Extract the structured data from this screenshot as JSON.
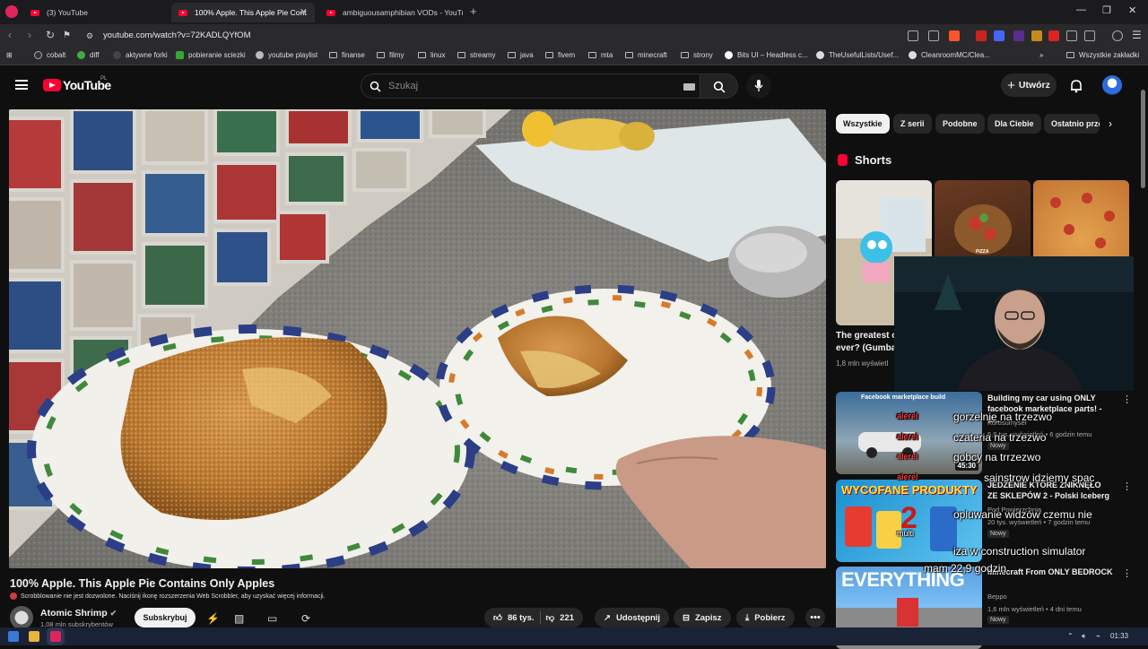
{
  "browser": {
    "tabs": [
      {
        "label": "(3) YouTube",
        "active": false
      },
      {
        "label": "100% Apple. This Apple Pie Cont",
        "active": true
      },
      {
        "label": "ambiguousamphibian VODs - YouTu",
        "active": false
      }
    ],
    "new_tab": "+",
    "window_controls": {
      "minimize": "—",
      "restore": "❐",
      "close": "✕"
    },
    "url": "youtube.com/watch?v=72KADLQYfOM",
    "bookmarks": [
      "cobalt",
      "diff",
      "aktywne forki",
      "pobieranie sciezki",
      "youtube playlist",
      "finanse",
      "filmy",
      "linux",
      "streamy",
      "java",
      "fivem",
      "mta",
      "minecraft",
      "strony",
      "Bits UI – Headless c...",
      "TheUsefulLists/Usef...",
      "CleanroomMC/Clea..."
    ],
    "bookmarks_overflow": "»",
    "other_bookmarks": "Wszystkie zakładki"
  },
  "youtube": {
    "logo_text": "YouTube",
    "country_code": "PL",
    "search_placeholder": "Szukaj",
    "create_label": "Utwórz"
  },
  "video": {
    "title": "100% Apple. This Apple Pie Contains Only Apples",
    "scrobbler_notice": "Scrobblowanie nie jest dozwolone. Naciśnij ikonę rozszerzenia Web Scrobbler, aby uzyskać więcej informacji.",
    "channel": "Atomic Shrimp",
    "subscribers": "1,08 mln subskrybentów",
    "subscribe_label": "Subskrybuj",
    "likes": "86 tys.",
    "dislikes": "221",
    "share_label": "Udostępnij",
    "save_label": "Zapisz",
    "download_label": "Pobierz",
    "more_label": "•••"
  },
  "sidebar": {
    "chips": [
      "Wszystkie",
      "Z serii",
      "Podobne",
      "Dla Ciebie",
      "Ostatnio przesłane"
    ],
    "shorts_heading": "Shorts",
    "shorts": [
      {
        "title": "The greatest c ever? (Gumba",
        "views": "1,8 mln wyświetl"
      },
      {
        "title": "",
        "views": ""
      },
      {
        "title": "",
        "views": ""
      }
    ],
    "shorts_tags": {
      "short_2_label": "PIZZA"
    },
    "recommendations": [
      {
        "title": "Building my car using ONLY facebook marketplace parts! - E...",
        "channel": "Korosumyser",
        "meta": "5,8 tys. wyświetleń • 6 godzin temu",
        "badge": "Nowy",
        "duration": "45:30",
        "thumb_text": "Facebook marketplace build"
      },
      {
        "title": "JEDZENIE KTÓRE ZNIKNĘŁO ZE SKLEPÓW 2 - Polski Iceberg",
        "channel": "Pod Powierzchnią",
        "meta": "20 tys. wyświetleń • 7 godzin temu",
        "badge": "Nowy",
        "duration": "",
        "thumb_text": "WYCOFANE PRODUKTY"
      },
      {
        "title": "Minecraft From ONLY BEDROCK",
        "channel": "Beppo",
        "meta": "1,6 mln wyświetleń • 4 dni temu",
        "badge": "Nowy",
        "duration": "",
        "thumb_text": "EVERYTHING"
      }
    ]
  },
  "chat_overlay": [
    "gorzelnie na trzezwo",
    "alerel",
    "czateria na trzezwo",
    "alerel",
    "gobcy na trrzezwo",
    "sainstrow idziemy spac",
    "alerel",
    "multi",
    "opluwanie widzów czemu nie",
    "iza w construction simulator",
    "mam 22,9 godzin"
  ],
  "thumb_badges": {
    "rec1_alerts": [
      "alerel",
      "alerel",
      "alerel"
    ],
    "rec2_number": "2"
  },
  "taskbar": {
    "time": "01:33"
  },
  "colors": {
    "accent": "#ff0033",
    "background": "#0f0f0f",
    "chip_active": "#f1f1f1"
  }
}
